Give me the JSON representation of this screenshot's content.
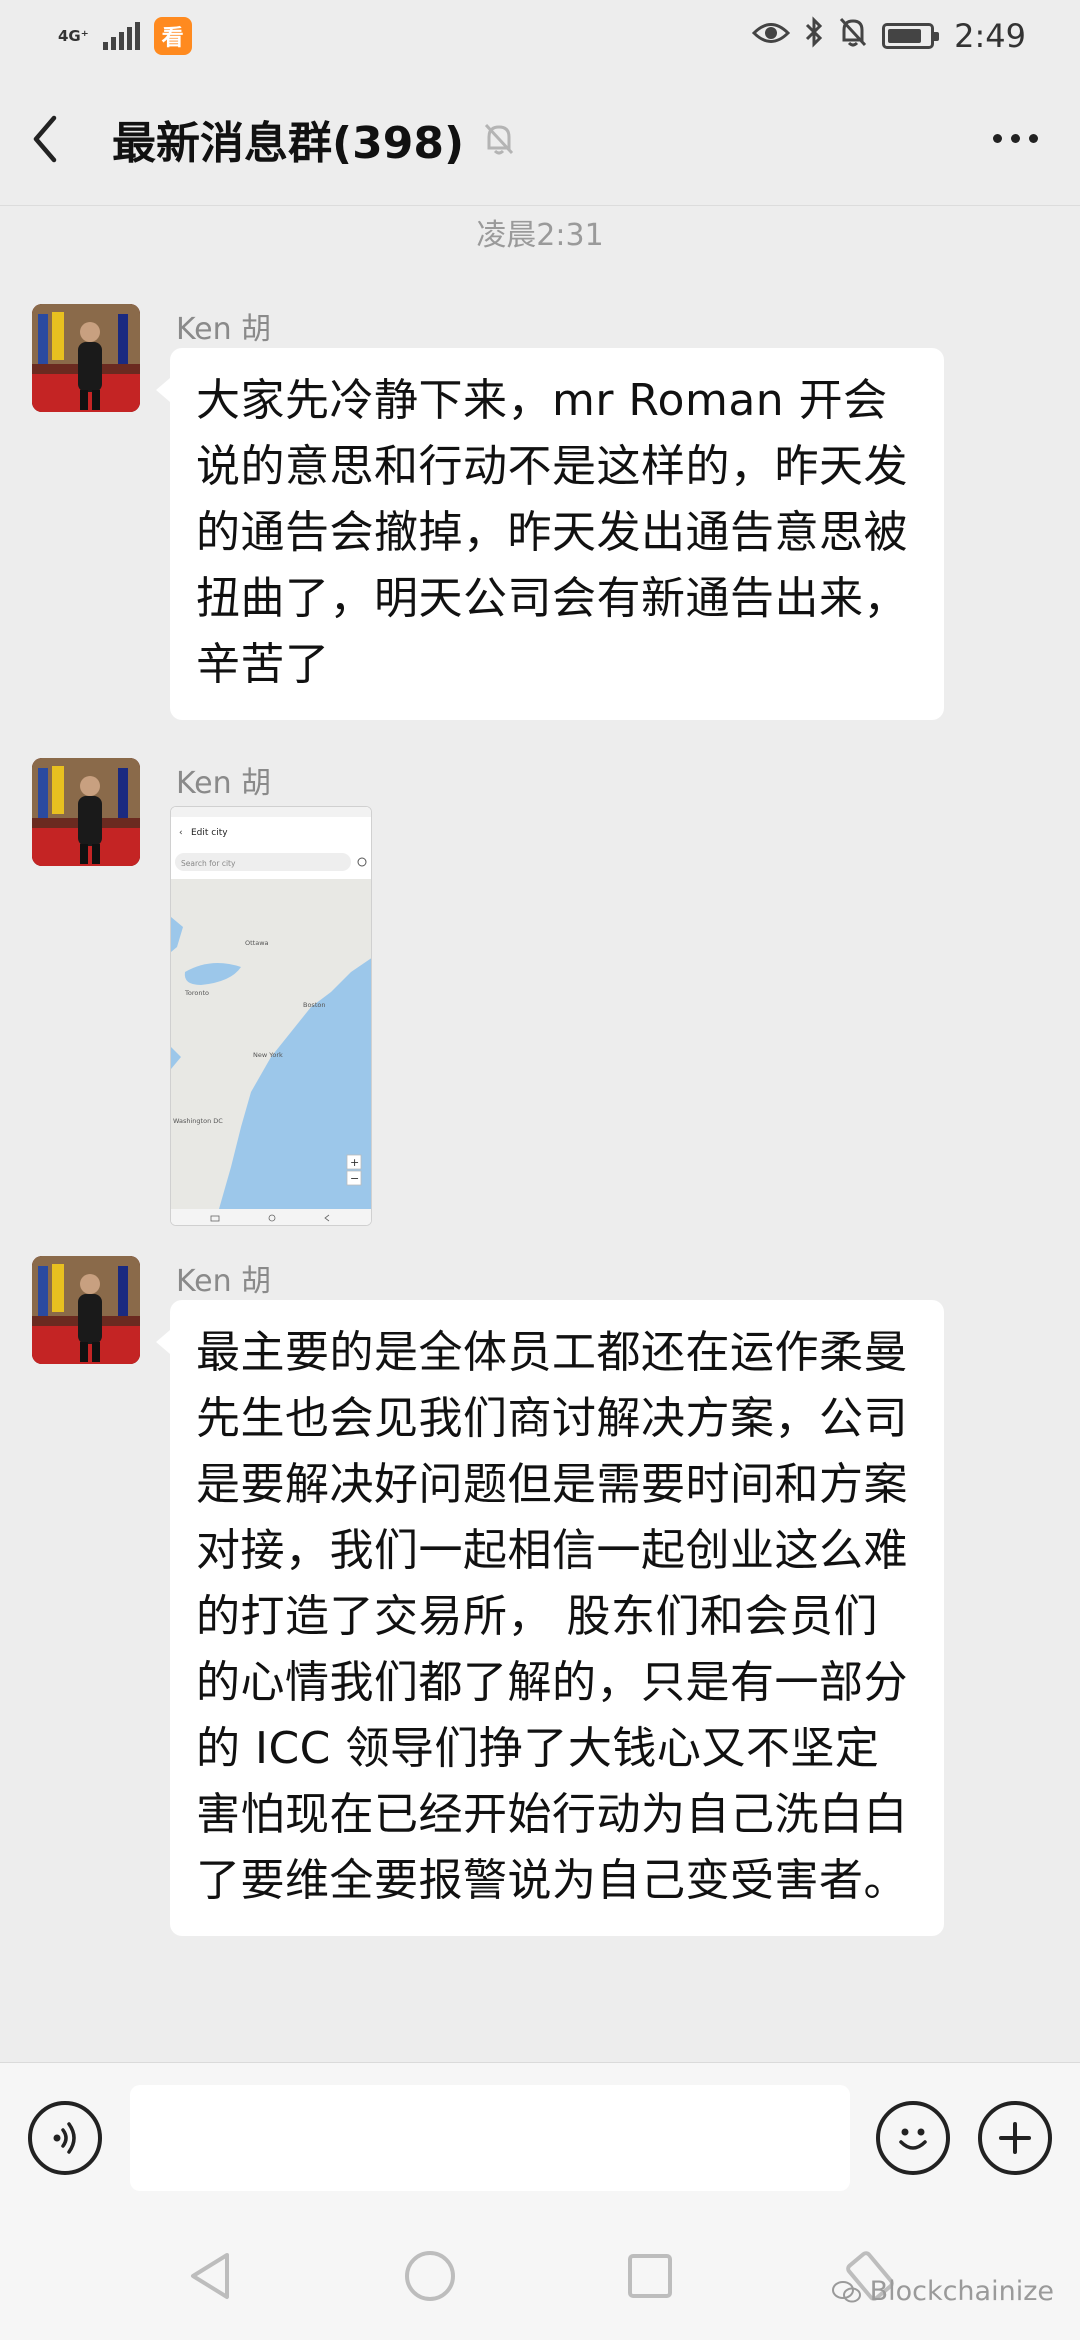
{
  "status_bar": {
    "network": "4G⁺",
    "app_badge": "看",
    "time": "2:49",
    "icons": [
      "eye-icon",
      "bluetooth-icon",
      "bell-off-icon",
      "battery-icon"
    ]
  },
  "header": {
    "title": "最新消息群(398)",
    "back_icon": "chevron-left-icon",
    "mute_icon": "bell-off-icon",
    "more_icon": "more-dots-icon"
  },
  "chat": {
    "time_divider": "凌晨2:31",
    "messages": [
      {
        "sender": "Ken 胡",
        "type": "text",
        "text": "大家先冷静下来，mr Roman 开会说的意思和行动不是这样的，昨天发的通告会撤掉，昨天发出通告意思被扭曲了，明天公司会有新通告出来， 辛苦了"
      },
      {
        "sender": "Ken 胡",
        "type": "image",
        "image": {
          "header": "Edit city",
          "search_placeholder": "Search for city",
          "cities": [
            "Ottawa",
            "Toronto",
            "Boston",
            "New York",
            "Washington DC"
          ],
          "zoom_in": "+",
          "zoom_out": "−"
        }
      },
      {
        "sender": "Ken 胡",
        "type": "text",
        "text": "最主要的是全体员工都还在运作柔曼先生也会见我们商讨解决方案，公司是要解决好问题但是需要时间和方案对接，我们一起相信一起创业这么难的打造了交易所， 股东们和会员们的心情我们都了解的，只是有一部分的 ICC 领导们挣了大钱心又不坚定害怕现在已经开始行动为自己洗白白了要维全要报警说为自己变受害者。"
      }
    ]
  },
  "input_bar": {
    "voice_icon": "voice-icon",
    "input_value": "",
    "emoji_icon": "emoji-icon",
    "plus_icon": "plus-icon"
  },
  "nav_bar": {
    "icons": [
      "back-triangle-icon",
      "home-circle-icon",
      "recents-square-icon",
      "rotate-icon"
    ]
  },
  "watermark": "Blockchainize"
}
